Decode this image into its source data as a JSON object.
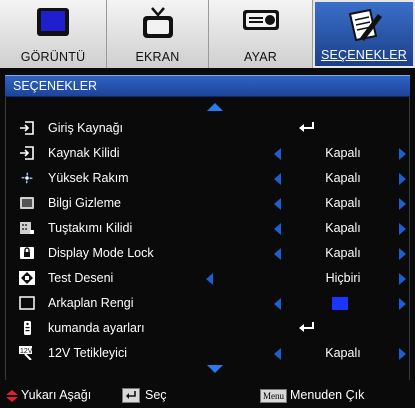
{
  "tabs": [
    {
      "label": "GÖRÜNTÜ",
      "icon": "monitor-icon"
    },
    {
      "label": "EKRAN",
      "icon": "tv-icon"
    },
    {
      "label": "AYAR",
      "icon": "projector-icon"
    },
    {
      "label": "SEÇENEKLER",
      "icon": "notepad-pencil-icon",
      "active": true
    }
  ],
  "header": {
    "title": "SEÇENEKLER"
  },
  "rows": [
    {
      "name": "Giriş Kaynağı",
      "icon": "input-source-icon",
      "type": "enter"
    },
    {
      "name": "Kaynak Kilidi",
      "icon": "input-lock-icon",
      "type": "option",
      "value": "Kapalı"
    },
    {
      "name": "Yüksek Rakım",
      "icon": "fan-icon",
      "type": "option",
      "value": "Kapalı"
    },
    {
      "name": "Bilgi Gizleme",
      "icon": "info-hide-icon",
      "type": "option",
      "value": "Kapalı"
    },
    {
      "name": "Tuştakımı Kilidi",
      "icon": "keypad-lock-icon",
      "type": "option",
      "value": "Kapalı"
    },
    {
      "name": "Display Mode Lock",
      "icon": "display-lock-icon",
      "type": "option",
      "value": "Kapalı"
    },
    {
      "name": "Test Deseni",
      "icon": "test-pattern-icon",
      "type": "option-wide",
      "value": "Hiçbiri"
    },
    {
      "name": "Arkaplan Rengi",
      "icon": "background-color-icon",
      "type": "color",
      "value_color": "#1a35ff"
    },
    {
      "name": "kumanda ayarları",
      "icon": "remote-icon",
      "type": "enter"
    },
    {
      "name": "12V Tetikleyici",
      "icon": "trigger-12v-icon",
      "type": "option",
      "value": "Kapalı"
    }
  ],
  "footer": {
    "updown": "Yukarı Aşağı",
    "select": "Seç",
    "menu_key": "Menu",
    "exit": "Menuden Çık"
  },
  "colors": {
    "accent": "#1d5ed0",
    "header": "#2f63c4"
  }
}
